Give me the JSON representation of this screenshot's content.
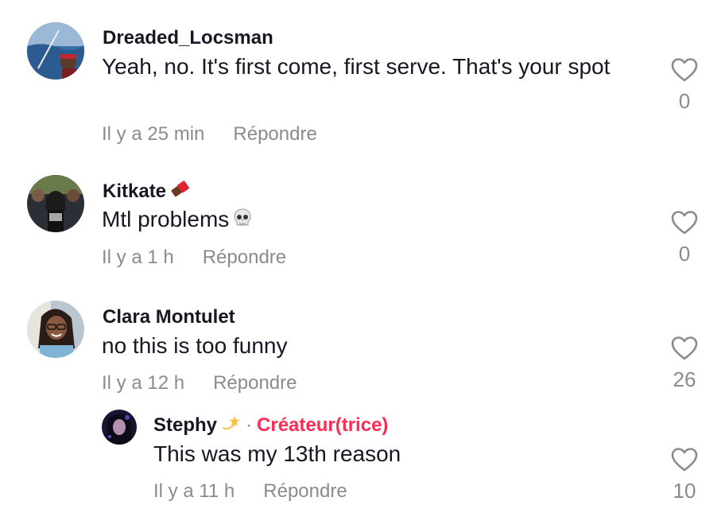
{
  "comments": [
    {
      "username": "Dreaded_Locsman",
      "text": "Yeah, no. It's first come, first serve. That's your spot",
      "time": "Il y a 25 min",
      "reply_label": "Répondre",
      "likes": "0",
      "avatar": "avatar-ocean-photo"
    },
    {
      "username": "Kitkate",
      "username_emoji": "chocolate-bar-icon",
      "text": "Mtl problems",
      "text_emoji": "skull-icon",
      "time": "Il y a 1 h",
      "reply_label": "Répondre",
      "likes": "0",
      "avatar": "avatar-group-photo"
    },
    {
      "username": "Clara Montulet",
      "text": "no this is too funny",
      "time": "Il y a 12 h",
      "reply_label": "Répondre",
      "likes": "26",
      "avatar": "avatar-selfie-photo"
    }
  ],
  "reply": {
    "username": "Stephy",
    "username_emoji": "dizzy-star-icon",
    "separator": "·",
    "creator_label": "Créateur(trice)",
    "text": "This was my 13th reason",
    "time": "Il y a 11 h",
    "reply_label": "Répondre",
    "likes": "10",
    "avatar": "avatar-dark-photo"
  },
  "colors": {
    "text": "#161823",
    "muted": "#8a8b91",
    "creator": "#fe2c55"
  },
  "icons": [
    "heart-outline-icon"
  ]
}
